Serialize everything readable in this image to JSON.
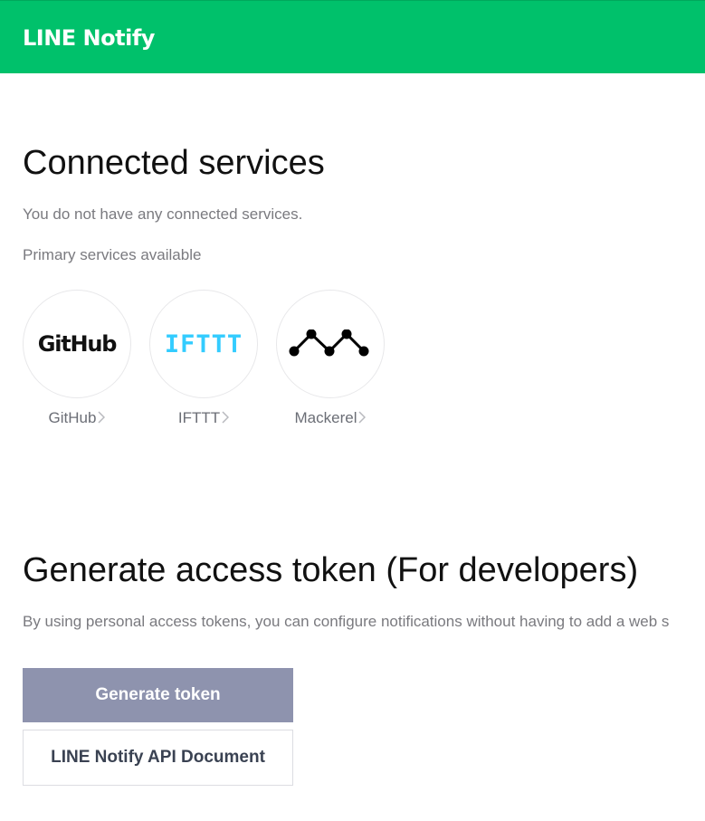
{
  "header": {
    "logo": "LINE Notify",
    "background_color": "#00c16b"
  },
  "connected": {
    "title": "Connected services",
    "empty_message": "You do not have any connected services.",
    "primary_label": "Primary services available",
    "services": [
      {
        "label": "GitHub",
        "icon": "github-logo-icon",
        "logo_text": "GitHub"
      },
      {
        "label": "IFTTT",
        "icon": "ifttt-logo-icon",
        "logo_text": "IFTTT"
      },
      {
        "label": "Mackerel",
        "icon": "mackerel-logo-icon"
      }
    ]
  },
  "developers": {
    "title": "Generate access token (For developers)",
    "description": "By using personal access tokens, you can configure notifications without having to add a web s",
    "generate_button": "Generate token",
    "api_doc_button": "LINE Notify API Document",
    "button_color": "#8e93ae"
  }
}
